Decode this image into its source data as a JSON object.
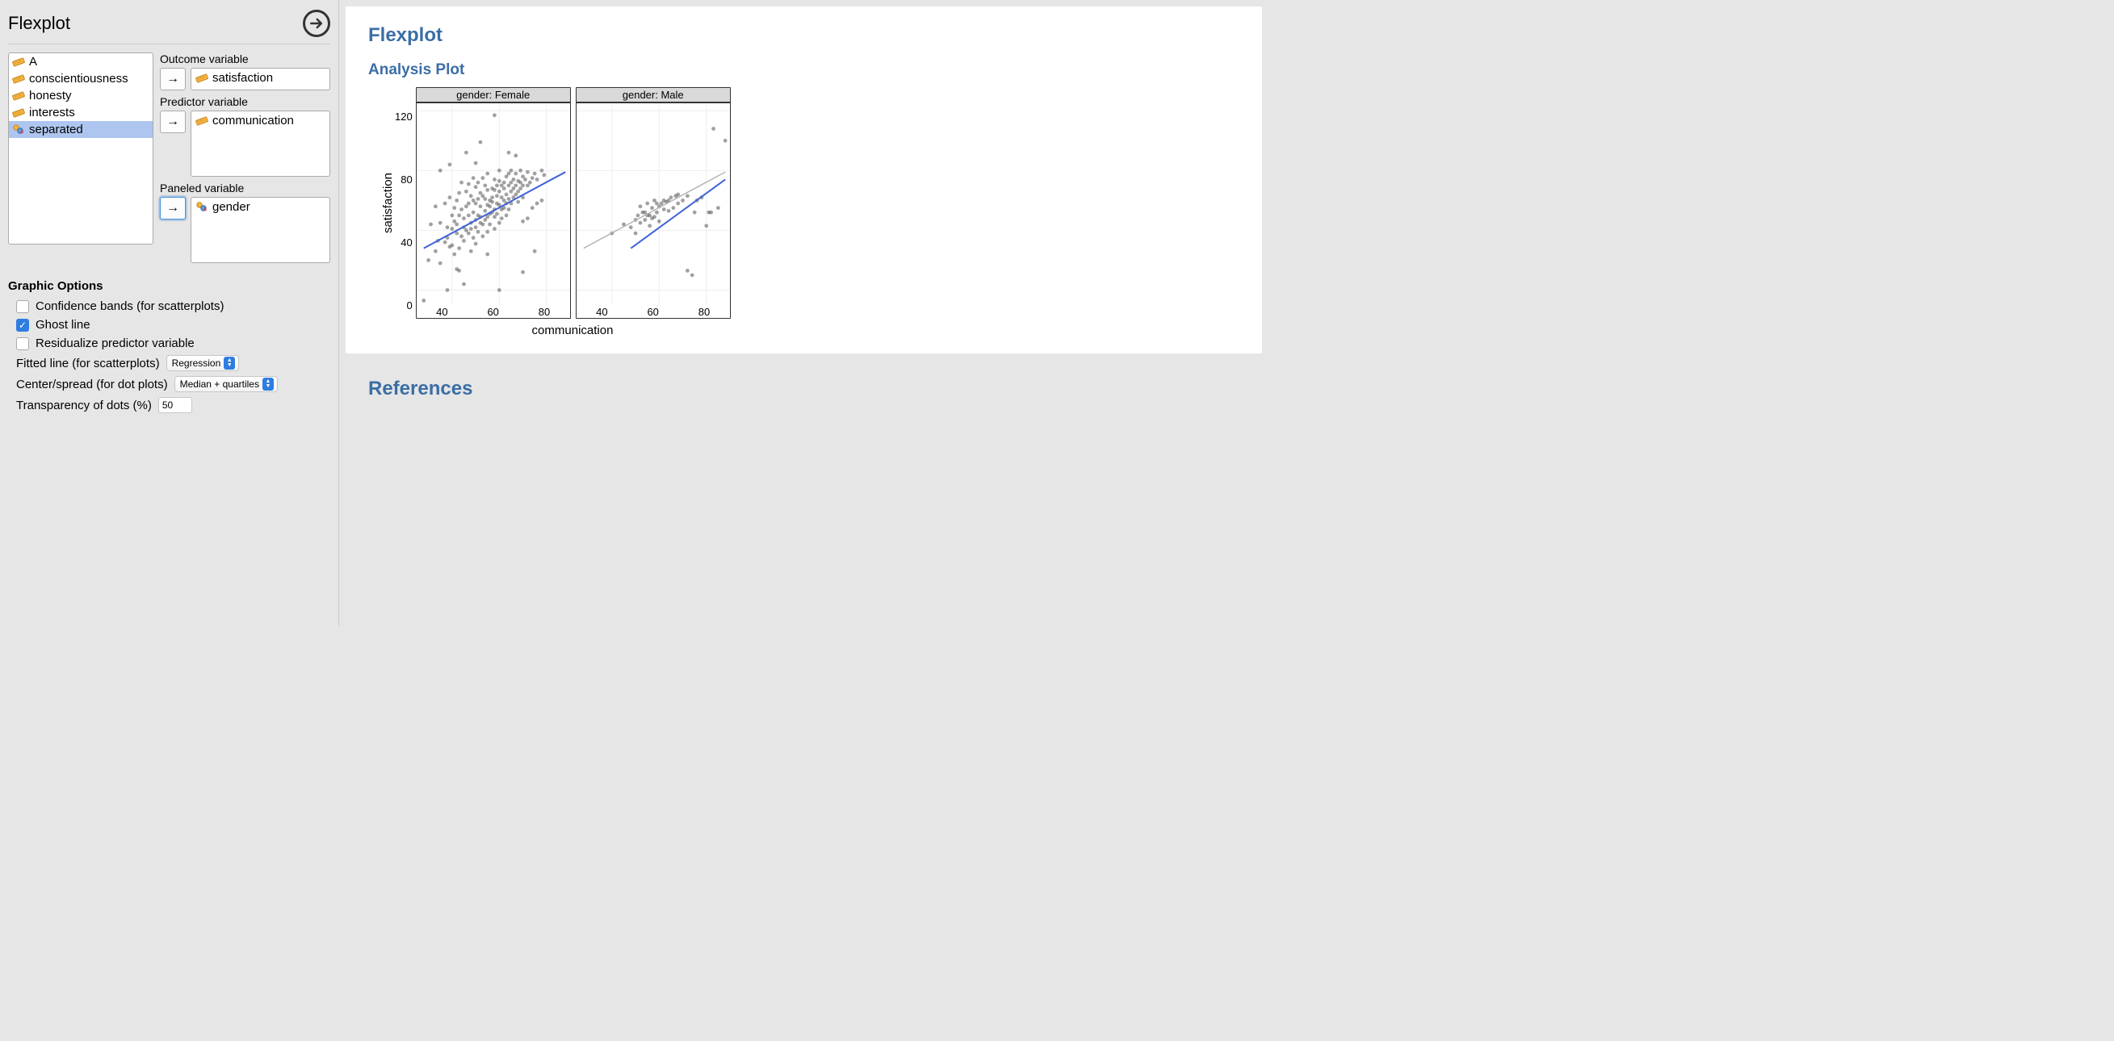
{
  "panel_title": "Flexplot",
  "variables": {
    "available": [
      "A",
      "conscientiousness",
      "honesty",
      "interests",
      "separated"
    ],
    "selected_index": 4,
    "types": [
      "scale",
      "scale",
      "scale",
      "scale",
      "nominal"
    ]
  },
  "assign": {
    "outcome": {
      "label": "Outcome variable",
      "value": "satisfaction",
      "type": "scale"
    },
    "predictor": {
      "label": "Predictor variable",
      "value": "communication",
      "type": "scale"
    },
    "paneled": {
      "label": "Paneled variable",
      "value": "gender",
      "type": "nominal",
      "active": true
    }
  },
  "options": {
    "section": "Graphic Options",
    "confidence": {
      "label": "Confidence bands (for scatterplots)",
      "checked": false
    },
    "ghost": {
      "label": "Ghost line",
      "checked": true
    },
    "residualize": {
      "label": "Residualize predictor variable",
      "checked": false
    },
    "fitted": {
      "label": "Fitted line (for scatterplots)",
      "value": "Regression"
    },
    "center": {
      "label": "Center/spread (for dot plots)",
      "value": "Median + quartiles"
    },
    "transparency": {
      "label": "Transparency of dots (%)",
      "value": "50"
    }
  },
  "output": {
    "title": "Flexplot",
    "subtitle": "Analysis Plot",
    "references": "References",
    "xlabel": "communication",
    "ylabel": "satisfaction"
  },
  "chart_data": {
    "type": "scatter",
    "xlabel": "communication",
    "ylabel": "satisfaction",
    "xlim": [
      25,
      90
    ],
    "ylim": [
      -10,
      125
    ],
    "x_ticks": [
      40,
      60,
      80
    ],
    "y_ticks": [
      0,
      40,
      80,
      120
    ],
    "facets": [
      {
        "label": "gender: Female",
        "ghost_line": {
          "x1": 28,
          "y1": 28,
          "x2": 88,
          "y2": 79
        },
        "fit_line": {
          "x1": 28,
          "y1": 28,
          "x2": 88,
          "y2": 79
        },
        "points": [
          [
            28,
            -7
          ],
          [
            30,
            20
          ],
          [
            31,
            44
          ],
          [
            33,
            26
          ],
          [
            33,
            56
          ],
          [
            34,
            33
          ],
          [
            35,
            18
          ],
          [
            35,
            45
          ],
          [
            37,
            58
          ],
          [
            37,
            32
          ],
          [
            38,
            35
          ],
          [
            38,
            42
          ],
          [
            39,
            29
          ],
          [
            39,
            62
          ],
          [
            39,
            84
          ],
          [
            40,
            30
          ],
          [
            40,
            41
          ],
          [
            40,
            50
          ],
          [
            41,
            24
          ],
          [
            41,
            55
          ],
          [
            41,
            46
          ],
          [
            42,
            38
          ],
          [
            42,
            44
          ],
          [
            42,
            60
          ],
          [
            43,
            65
          ],
          [
            43,
            28
          ],
          [
            43,
            50
          ],
          [
            44,
            36
          ],
          [
            44,
            54
          ],
          [
            44,
            72
          ],
          [
            45,
            33
          ],
          [
            45,
            48
          ],
          [
            45,
            42
          ],
          [
            46,
            56
          ],
          [
            46,
            40
          ],
          [
            46,
            66
          ],
          [
            47,
            38
          ],
          [
            47,
            50
          ],
          [
            47,
            58
          ],
          [
            47,
            71
          ],
          [
            48,
            26
          ],
          [
            48,
            45
          ],
          [
            48,
            63
          ],
          [
            48,
            41
          ],
          [
            49,
            52
          ],
          [
            49,
            60
          ],
          [
            49,
            35
          ],
          [
            49,
            75
          ],
          [
            50,
            47
          ],
          [
            50,
            31
          ],
          [
            50,
            42
          ],
          [
            50,
            58
          ],
          [
            50,
            69
          ],
          [
            51,
            50
          ],
          [
            51,
            39
          ],
          [
            51,
            61
          ],
          [
            51,
            72
          ],
          [
            52,
            56
          ],
          [
            52,
            45
          ],
          [
            52,
            49
          ],
          [
            52,
            65
          ],
          [
            53,
            63
          ],
          [
            53,
            44
          ],
          [
            53,
            36
          ],
          [
            53,
            75
          ],
          [
            54,
            53
          ],
          [
            54,
            61
          ],
          [
            54,
            47
          ],
          [
            54,
            70
          ],
          [
            55,
            57
          ],
          [
            55,
            49
          ],
          [
            55,
            67
          ],
          [
            55,
            39
          ],
          [
            55,
            78
          ],
          [
            56,
            56
          ],
          [
            56,
            60
          ],
          [
            56,
            51
          ],
          [
            56,
            44
          ],
          [
            57,
            62
          ],
          [
            57,
            68
          ],
          [
            57,
            52
          ],
          [
            57,
            59
          ],
          [
            58,
            54
          ],
          [
            58,
            49
          ],
          [
            58,
            67
          ],
          [
            58,
            74
          ],
          [
            58,
            41
          ],
          [
            59,
            58
          ],
          [
            59,
            63
          ],
          [
            59,
            70
          ],
          [
            59,
            51
          ],
          [
            60,
            66
          ],
          [
            60,
            45
          ],
          [
            60,
            57
          ],
          [
            60,
            73
          ],
          [
            60,
            80
          ],
          [
            61,
            62
          ],
          [
            61,
            54
          ],
          [
            61,
            70
          ],
          [
            61,
            48
          ],
          [
            62,
            60
          ],
          [
            62,
            72
          ],
          [
            62,
            55
          ],
          [
            62,
            68
          ],
          [
            63,
            64
          ],
          [
            63,
            58
          ],
          [
            63,
            76
          ],
          [
            63,
            50
          ],
          [
            64,
            70
          ],
          [
            64,
            61
          ],
          [
            64,
            78
          ],
          [
            64,
            54
          ],
          [
            65,
            66
          ],
          [
            65,
            72
          ],
          [
            65,
            58
          ],
          [
            65,
            80
          ],
          [
            66,
            68
          ],
          [
            66,
            62
          ],
          [
            66,
            74
          ],
          [
            67,
            70
          ],
          [
            67,
            64
          ],
          [
            67,
            78
          ],
          [
            68,
            66
          ],
          [
            68,
            73
          ],
          [
            68,
            59
          ],
          [
            69,
            72
          ],
          [
            69,
            68
          ],
          [
            69,
            80
          ],
          [
            70,
            70
          ],
          [
            70,
            62
          ],
          [
            70,
            76
          ],
          [
            71,
            74
          ],
          [
            72,
            70
          ],
          [
            72,
            79
          ],
          [
            73,
            72
          ],
          [
            74,
            75
          ],
          [
            75,
            78
          ],
          [
            76,
            74
          ],
          [
            78,
            80
          ],
          [
            79,
            77
          ],
          [
            58,
            117
          ],
          [
            52,
            99
          ],
          [
            45,
            4
          ],
          [
            60,
            0
          ],
          [
            70,
            12
          ],
          [
            75,
            26
          ],
          [
            38,
            0
          ],
          [
            35,
            80
          ],
          [
            64,
            92
          ],
          [
            67,
            90
          ],
          [
            55,
            24
          ],
          [
            50,
            85
          ],
          [
            43,
            13
          ],
          [
            46,
            92
          ],
          [
            42,
            14
          ],
          [
            70,
            46
          ],
          [
            72,
            48
          ],
          [
            74,
            55
          ],
          [
            76,
            58
          ],
          [
            78,
            60
          ]
        ]
      },
      {
        "label": "gender: Male",
        "ghost_line": {
          "x1": 28,
          "y1": 28,
          "x2": 88,
          "y2": 79
        },
        "fit_line": {
          "x1": 48,
          "y1": 28,
          "x2": 88,
          "y2": 74
        },
        "points": [
          [
            40,
            38
          ],
          [
            45,
            44
          ],
          [
            48,
            42
          ],
          [
            50,
            47
          ],
          [
            50,
            38
          ],
          [
            51,
            50
          ],
          [
            52,
            56
          ],
          [
            52,
            45
          ],
          [
            53,
            52
          ],
          [
            54,
            52
          ],
          [
            54,
            47
          ],
          [
            55,
            50
          ],
          [
            55,
            58
          ],
          [
            56,
            50
          ],
          [
            56,
            43
          ],
          [
            57,
            55
          ],
          [
            57,
            48
          ],
          [
            58,
            60
          ],
          [
            58,
            49
          ],
          [
            59,
            52
          ],
          [
            59,
            58
          ],
          [
            60,
            56
          ],
          [
            60,
            46
          ],
          [
            61,
            58
          ],
          [
            62,
            54
          ],
          [
            62,
            60
          ],
          [
            63,
            59
          ],
          [
            64,
            60
          ],
          [
            64,
            53
          ],
          [
            65,
            62
          ],
          [
            66,
            55
          ],
          [
            67,
            63
          ],
          [
            68,
            58
          ],
          [
            68,
            64
          ],
          [
            70,
            60
          ],
          [
            72,
            63
          ],
          [
            72,
            13
          ],
          [
            74,
            10
          ],
          [
            75,
            52
          ],
          [
            76,
            60
          ],
          [
            78,
            62
          ],
          [
            80,
            43
          ],
          [
            81,
            52
          ],
          [
            82,
            52
          ],
          [
            83,
            108
          ],
          [
            85,
            55
          ],
          [
            88,
            100
          ]
        ]
      }
    ]
  }
}
